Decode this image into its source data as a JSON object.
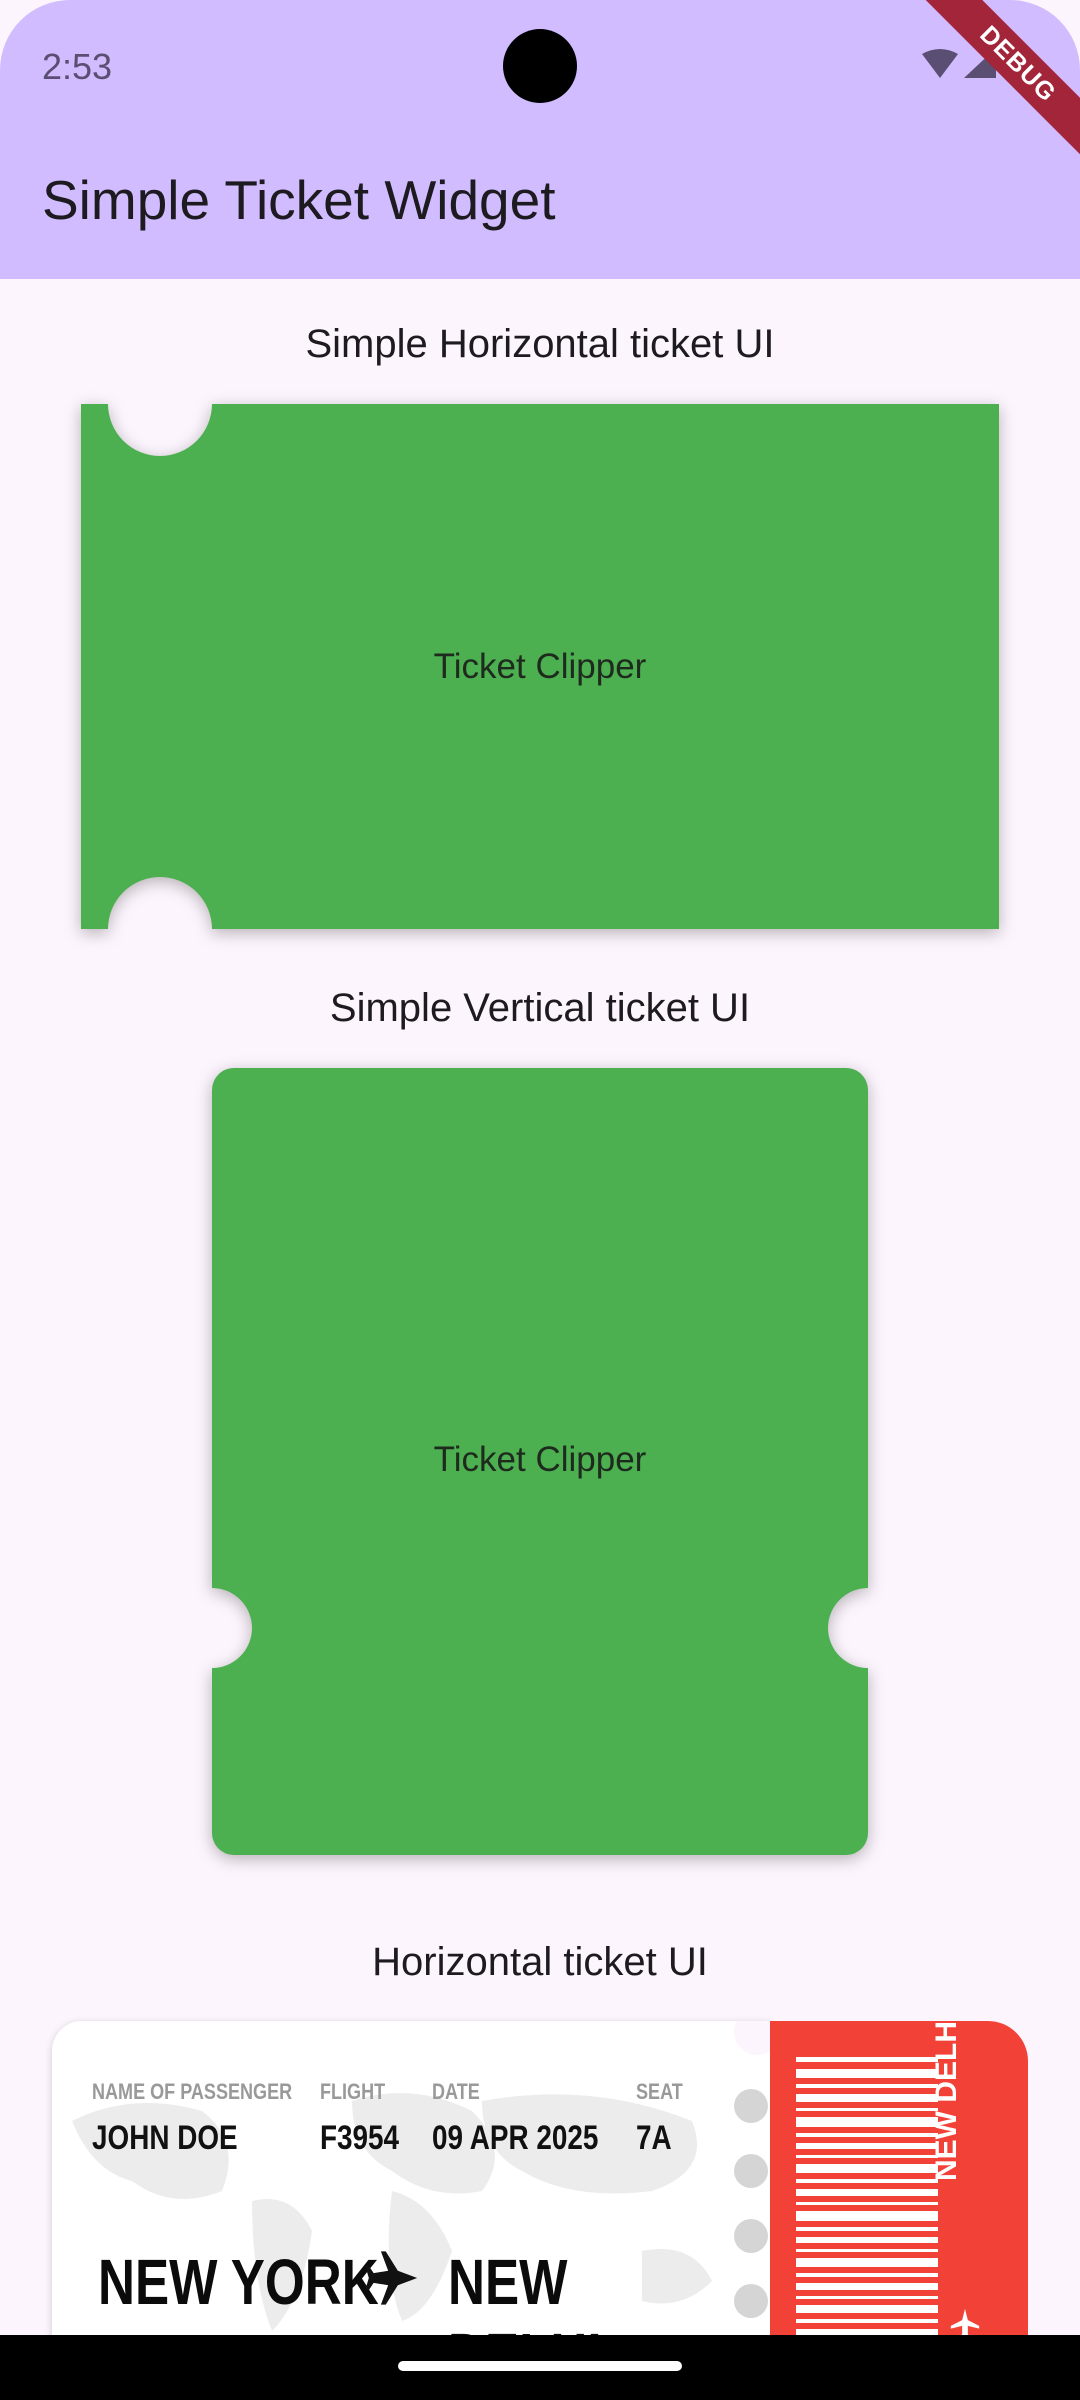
{
  "status_bar": {
    "time": "2:53"
  },
  "app_bar": {
    "title": "Simple Ticket Widget"
  },
  "debug_banner": {
    "label": "DEBUG"
  },
  "sections": {
    "horizontal_simple": {
      "title": "Simple Horizontal ticket UI",
      "ticket_label": "Ticket Clipper"
    },
    "vertical_simple": {
      "title": "Simple Vertical ticket UI",
      "ticket_label": "Ticket Clipper"
    },
    "horizontal_ticket": {
      "title": "Horizontal ticket UI"
    }
  },
  "boarding_pass": {
    "fields": [
      {
        "label": "NAME OF PASSENGER",
        "value": "JOHN DOE"
      },
      {
        "label": "FLIGHT",
        "value": "F3954"
      },
      {
        "label": "DATE",
        "value": "09 APR 2025"
      },
      {
        "label": "SEAT",
        "value": "7A"
      }
    ],
    "origin": "NEW YORK",
    "destination": "NEW DELHI",
    "stub_destination": "NEW DELHI"
  },
  "colors": {
    "app_bar": "#d0bcfe",
    "background": "#fdf5fd",
    "ticket_green": "#4caf50",
    "stub_red": "#f24238",
    "debug_ribbon": "#a3253a"
  },
  "icons": [
    "wifi-icon",
    "cellular-signal-icon",
    "battery-icon",
    "airplane-icon"
  ]
}
